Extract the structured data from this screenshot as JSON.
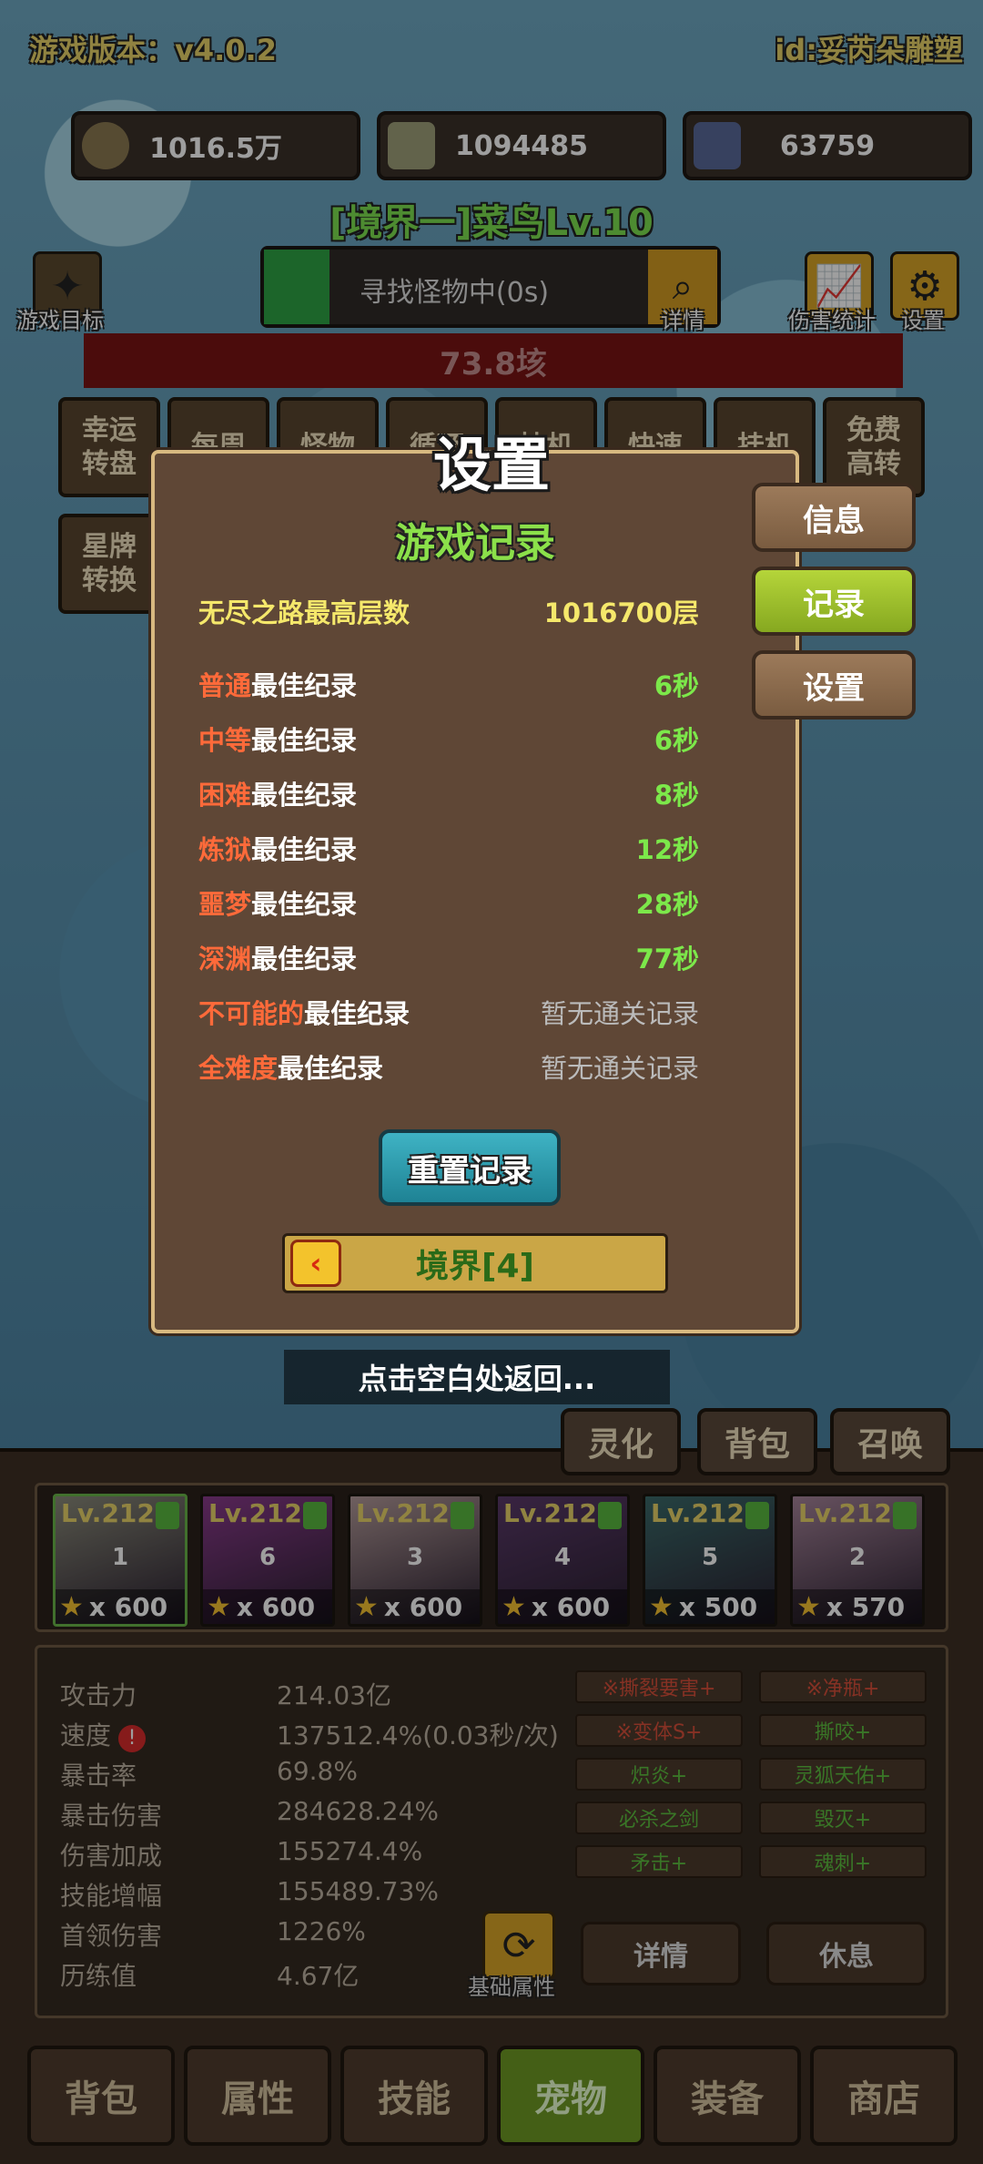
{
  "header": {
    "version": "游戏版本：v4.0.2",
    "user_id": "id:妥芮朵雕塑"
  },
  "resources": [
    {
      "icon": "coin-icon",
      "value": "1016.5万"
    },
    {
      "icon": "crystal-icon",
      "value": "1094485"
    },
    {
      "icon": "card-icon",
      "value": "63759"
    }
  ],
  "realm_title": "[境界一]菜鸟Lv.10",
  "toolbar": {
    "game_goal": "游戏目标",
    "search_status": "寻找怪物中(0s)",
    "details": "详情",
    "damage_stats": "伤害统计",
    "settings": "设置"
  },
  "boss_hp": "73.8垓",
  "activity_buttons": [
    {
      "line1": "幸运",
      "line2": "转盘"
    },
    {
      "line1": "每周",
      "line2": ""
    },
    {
      "line1": "怪物",
      "line2": ""
    },
    {
      "line1": "循环",
      "line2": ""
    },
    {
      "line1": "挂机",
      "line2": ""
    },
    {
      "line1": "快速",
      "line2": ""
    },
    {
      "line1": "挂机",
      "line2": ""
    },
    {
      "line1": "免费",
      "line2": "高转"
    },
    {
      "line1": "星牌",
      "line2": "转换"
    }
  ],
  "dialog": {
    "title": "设置",
    "subtitle": "游戏记录",
    "endless_label": "无尽之路最高层数",
    "endless_value": "1016700层",
    "records": [
      {
        "difficulty": "普通",
        "suffix": "最佳纪录",
        "value": "6秒"
      },
      {
        "difficulty": "中等",
        "suffix": "最佳纪录",
        "value": "6秒"
      },
      {
        "difficulty": "困难",
        "suffix": "最佳纪录",
        "value": "8秒"
      },
      {
        "difficulty": "炼狱",
        "suffix": "最佳纪录",
        "value": "12秒"
      },
      {
        "difficulty": "噩梦",
        "suffix": "最佳纪录",
        "value": "28秒"
      },
      {
        "difficulty": "深渊",
        "suffix": "最佳纪录",
        "value": "77秒"
      },
      {
        "difficulty": "不可能的",
        "suffix": "最佳纪录",
        "value": "暂无通关记录"
      },
      {
        "difficulty": "全难度",
        "suffix": "最佳纪录",
        "value": "暂无通关记录"
      }
    ],
    "reset_button": "重置记录",
    "realm_selector": "境界[4]",
    "side_tabs": [
      "信息",
      "记录",
      "设置"
    ],
    "return_hint": "点击空白处返回..."
  },
  "panel_tabs": [
    "灵化",
    "背包",
    "召唤"
  ],
  "pets": [
    {
      "level": "Lv.212",
      "num": "1",
      "stars": "x 600",
      "color": "#8a8a7a"
    },
    {
      "level": "Lv.212",
      "num": "6",
      "stars": "x 600",
      "color": "#8a3b8c"
    },
    {
      "level": "Lv.212",
      "num": "3",
      "stars": "x 600",
      "color": "#b39a9a"
    },
    {
      "level": "Lv.212",
      "num": "4",
      "stars": "x 600",
      "color": "#5b3a6a"
    },
    {
      "level": "Lv.212",
      "num": "5",
      "stars": "x 500",
      "color": "#3b6a6a"
    },
    {
      "level": "Lv.212",
      "num": "2",
      "stars": "x 570",
      "color": "#a6849a"
    }
  ],
  "stats": [
    {
      "label": "攻击力",
      "value": "214.03亿"
    },
    {
      "label": "速度",
      "value": "137512.4%(0.03秒/次)",
      "warn": "!"
    },
    {
      "label": "暴击率",
      "value": "69.8%"
    },
    {
      "label": "暴击伤害",
      "value": "284628.24%"
    },
    {
      "label": "伤害加成",
      "value": "155274.4%"
    },
    {
      "label": "技能增幅",
      "value": "155489.73%"
    },
    {
      "label": "首领伤害",
      "value": "1226%"
    },
    {
      "label": "历练值",
      "value": "4.67亿"
    }
  ],
  "skill_tags": [
    {
      "text": "※撕裂要害+",
      "tone": "red"
    },
    {
      "text": "※净瓶+",
      "tone": "red"
    },
    {
      "text": "※变体S+",
      "tone": "red"
    },
    {
      "text": "撕咬+",
      "tone": "grn"
    },
    {
      "text": "炽炎+",
      "tone": "grn"
    },
    {
      "text": "灵狐天佑+",
      "tone": "grn"
    },
    {
      "text": "必杀之剑",
      "tone": "grn"
    },
    {
      "text": "毁灭+",
      "tone": "grn"
    },
    {
      "text": "矛击+",
      "tone": "grn"
    },
    {
      "text": "魂刺+",
      "tone": "grn"
    }
  ],
  "stat_buttons": {
    "base_attr": "基础属性",
    "details": "详情",
    "rest": "休息"
  },
  "bottom_nav": [
    "背包",
    "属性",
    "技能",
    "宠物",
    "装备",
    "商店"
  ]
}
